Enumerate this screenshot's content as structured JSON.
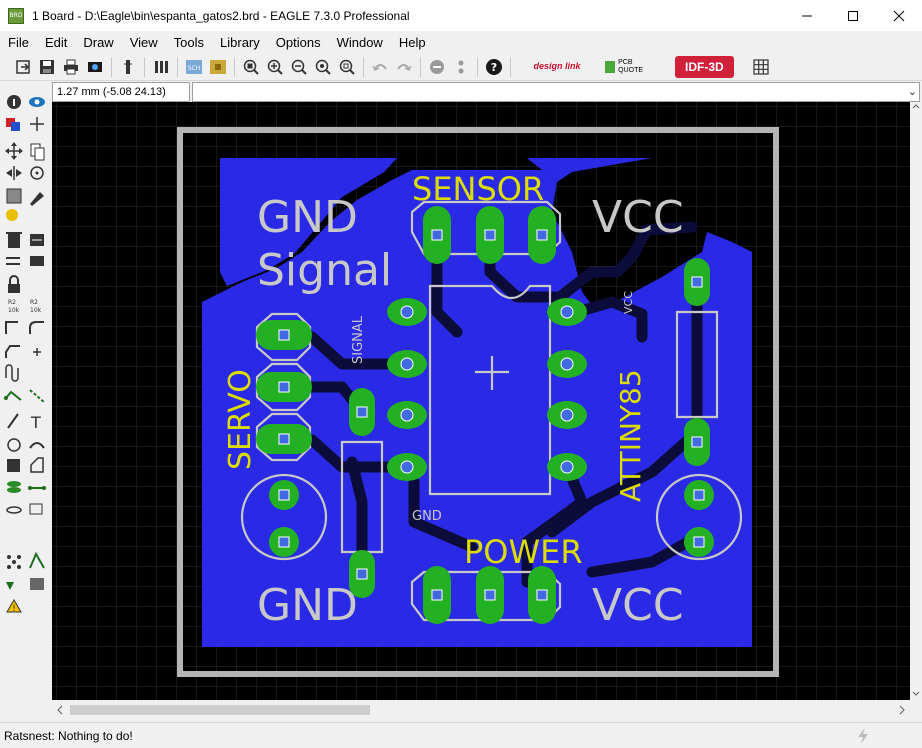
{
  "window": {
    "app_icon_label": "BRD",
    "title": "1 Board - D:\\Eagle\\bin\\espanta_gatos2.brd - EAGLE 7.3.0 Professional"
  },
  "menu": [
    "File",
    "Edit",
    "Draw",
    "View",
    "Tools",
    "Library",
    "Options",
    "Window",
    "Help"
  ],
  "toolbar": {
    "design_link_label": "design link",
    "pcb_quote_label": "PCB QUOTE",
    "idf_label": "IDF-3D",
    "sch_label": "SCH"
  },
  "coord_display": "1.27 mm (-5.08 24.13)",
  "command_line": {
    "value": ""
  },
  "board": {
    "labels": {
      "sensor": "SENSOR",
      "power": "POWER",
      "gnd_top": "GND",
      "gnd_bottom": "GND",
      "vcc_top": "VCC",
      "vcc_bottom": "VCC",
      "signal_large": "Signal",
      "servo": "SERVO",
      "attiny": "ATTINY85",
      "signal_small": "SIGNAL",
      "vcc_small": "VCC",
      "gnd_small": "GND"
    },
    "colors": {
      "background": "#000000",
      "grid": "#2e2e2e",
      "outline": "#b4b4b4",
      "copper": "#2a2ae6",
      "trace_dark": "#0c0c3a",
      "pad": "#23b023",
      "drill": "#4169e1",
      "silk": "#c8c8c8",
      "text_yellow": "#dcdc00",
      "r_label_text": "#7a7a7a"
    }
  },
  "status": {
    "message": "Ratsnest: Nothing to do!"
  }
}
